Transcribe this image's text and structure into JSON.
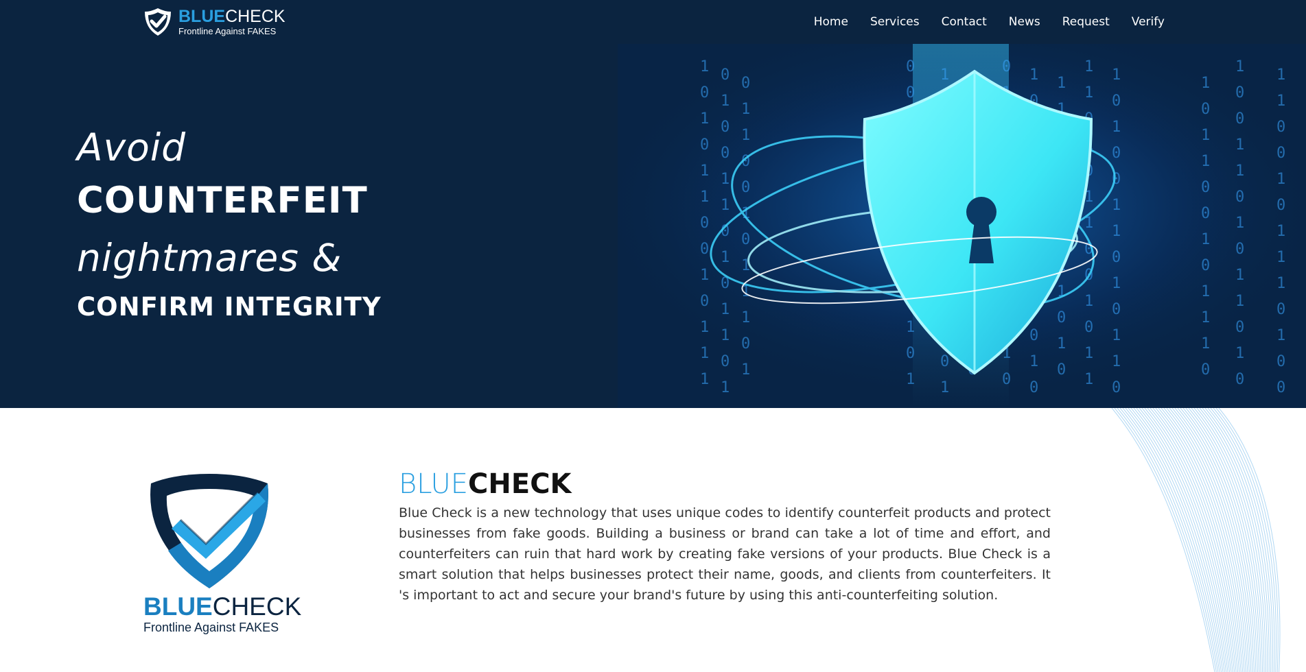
{
  "nav": {
    "brand_name_part1": "BLUE",
    "brand_name_part2": "CHECK",
    "brand_tagline": "Frontline Against FAKES",
    "links": [
      "Home",
      "Services",
      "Contact",
      "News",
      "Request",
      "Verify"
    ]
  },
  "hero": {
    "line1": "Avoid",
    "line2": "COUNTERFEIT",
    "line3": "nightmares &",
    "line4": "CONFIRM INTEGRITY",
    "art_digits": [
      "1",
      "0",
      "1",
      "0",
      "1",
      "1",
      "0",
      "0",
      "1",
      "0",
      "1",
      "1",
      "1",
      "0",
      "1",
      "0",
      "0",
      "1",
      "1",
      "0",
      "1",
      "0",
      "1"
    ]
  },
  "about": {
    "logo_name_part1": "BLUE",
    "logo_name_part2": "CHECK",
    "logo_tagline": "Frontline Against FAKES",
    "heading_part1": "BLUE",
    "heading_part2": "CHECK",
    "body": "Blue Check is a new technology that uses unique codes to identify counterfeit products and protect businesses from fake goods. Building a business or brand can take a lot of time and effort, and counterfeiters can ruin that hard work by creating fake versions of your products. Blue Check is a smart solution that helps businesses protect their name, goods, and clients from counterfeiters. It 's important to act and secure your brand's future by using this anti-counterfeiting solution."
  },
  "colors": {
    "navy": "#0b2440",
    "accent_blue": "#2a9fe0",
    "cyan_glow": "#4ff3ff"
  }
}
